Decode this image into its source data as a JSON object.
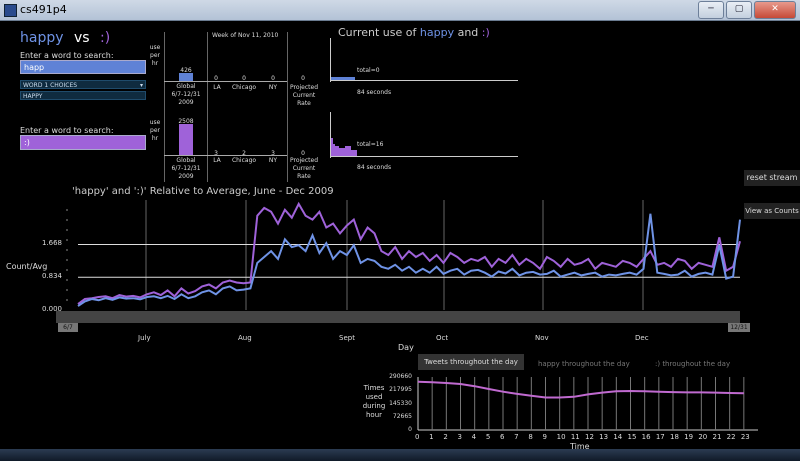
{
  "window": {
    "title": "cs491p4",
    "buttons": [
      "─",
      "▢",
      "✕"
    ]
  },
  "header": {
    "word1": "happy",
    "vs": "vs",
    "word2": ":)"
  },
  "search1": {
    "label": "Enter a word to search:",
    "value": "happ",
    "dropdown_title": "WORD 1 CHOICES",
    "dropdown_choice": "HAPPY"
  },
  "search2": {
    "label": "Enter a word to search:",
    "value": ":)"
  },
  "stats": {
    "axis_label": [
      "use",
      "per",
      "hr"
    ],
    "week": "Week of Nov 11, 2010",
    "row1": {
      "global_value": "426",
      "la": "0",
      "chicago": "0",
      "ny": "0",
      "projected": "0"
    },
    "row2": {
      "global_value": "2508",
      "la": "3",
      "chicago": "2",
      "ny": "3",
      "projected": "0"
    },
    "labels": {
      "global": "Global",
      "global_range": "6/7-12/31",
      "global_year": "2009",
      "la": "LA",
      "chicago": "Chicago",
      "ny": "NY",
      "projected": "Projected",
      "current": "Current",
      "rate": "Rate"
    }
  },
  "current_use": {
    "title_prefix": "Current use of",
    "word1": "happy",
    "and": "and",
    "word2": ":)",
    "total1": "total=0",
    "seconds1": "84 seconds",
    "total2": "total=16",
    "seconds2": "84 seconds"
  },
  "buttons": {
    "reset": "reset stream",
    "view": "View as Counts"
  },
  "main_chart": {
    "title": "'happy'  and  ':)'  Relative to Average, June - Dec 2009",
    "ylabel": "Count/Avg",
    "xlabel": "Day",
    "start": "6/7",
    "end": "12/31"
  },
  "hourly": {
    "tabs": [
      "Tweets throughout the day",
      "happy throughout the day",
      ":) throughout the day"
    ],
    "ylabel": [
      "Times",
      "used",
      "during",
      "hour"
    ],
    "xlabel": "Time"
  },
  "chart_data": [
    {
      "type": "line",
      "title": "'happy'  and  ':)'  Relative to Average, June - Dec 2009",
      "xlabel": "Day",
      "ylabel": "Count/Avg",
      "y_ticks": [
        "0.000",
        "0.834",
        "1.668"
      ],
      "x_ticks": [
        "July",
        "Aug",
        "Sept",
        "Oct",
        "Nov",
        "Dec"
      ],
      "ylim": [
        0,
        2.8
      ],
      "series": [
        {
          "color": "#6f93e6",
          "values": [
            0.1,
            0.22,
            0.28,
            0.25,
            0.3,
            0.26,
            0.32,
            0.29,
            0.3,
            0.27,
            0.33,
            0.35,
            0.3,
            0.36,
            0.28,
            0.4,
            0.3,
            0.35,
            0.45,
            0.5,
            0.4,
            0.55,
            0.6,
            0.5,
            0.52,
            0.55,
            1.2,
            1.35,
            1.5,
            1.3,
            1.8,
            1.6,
            1.65,
            1.5,
            1.9,
            1.45,
            1.7,
            1.3,
            1.5,
            1.4,
            1.65,
            1.2,
            1.3,
            1.25,
            1.1,
            1.05,
            1.15,
            1.0,
            1.1,
            0.95,
            1.05,
            0.95,
            1.1,
            0.92,
            1.0,
            1.05,
            0.9,
            1.0,
            1.02,
            0.95,
            0.85,
            0.98,
            0.93,
            1.05,
            0.88,
            0.95,
            0.97,
            0.9,
            0.92,
            1.0,
            0.85,
            0.9,
            0.95,
            0.88,
            0.92,
            0.95,
            0.85,
            0.9,
            0.88,
            0.92,
            0.95,
            0.9,
            1.05,
            2.45,
            0.95,
            0.92,
            0.88,
            0.9,
            1.0,
            0.85,
            0.92,
            0.95,
            0.9,
            1.65,
            0.8,
            0.85,
            2.3
          ]
        },
        {
          "color": "#9f62d9",
          "values": [
            0.15,
            0.28,
            0.3,
            0.33,
            0.35,
            0.3,
            0.38,
            0.34,
            0.36,
            0.32,
            0.4,
            0.45,
            0.38,
            0.5,
            0.35,
            0.55,
            0.42,
            0.48,
            0.6,
            0.65,
            0.55,
            0.7,
            0.75,
            0.7,
            0.68,
            0.7,
            2.4,
            2.6,
            2.5,
            2.2,
            2.55,
            2.35,
            2.7,
            2.4,
            2.3,
            2.5,
            2.1,
            2.2,
            1.95,
            2.15,
            2.3,
            1.8,
            2.1,
            1.95,
            1.5,
            1.4,
            1.6,
            1.3,
            1.5,
            1.35,
            1.45,
            1.25,
            1.4,
            1.2,
            1.45,
            1.35,
            1.2,
            1.3,
            1.25,
            1.35,
            1.1,
            1.3,
            1.2,
            1.4,
            1.15,
            1.3,
            1.2,
            1.05,
            1.35,
            1.25,
            1.1,
            1.3,
            1.15,
            1.2,
            1.3,
            1.05,
            1.2,
            1.15,
            1.1,
            1.25,
            1.2,
            1.1,
            1.3,
            1.5,
            1.15,
            1.2,
            1.1,
            1.3,
            1.25,
            1.05,
            1.2,
            1.15,
            1.1,
            1.85,
            1.0,
            1.1,
            1.75
          ]
        }
      ]
    },
    {
      "type": "line",
      "title": "Tweets throughout the day",
      "xlabel": "Time",
      "ylabel": "Times used during hour",
      "x": [
        0,
        1,
        2,
        3,
        4,
        5,
        6,
        7,
        8,
        9,
        10,
        11,
        12,
        13,
        14,
        15,
        16,
        17,
        18,
        19,
        20,
        21,
        22,
        23
      ],
      "y_ticks": [
        "0",
        "72665",
        "145330",
        "217995",
        "290660"
      ],
      "ylim": [
        0,
        290660
      ],
      "series": [
        {
          "color": "#c06ad0",
          "values": [
            265000,
            262000,
            258000,
            252000,
            240000,
            225000,
            210000,
            198000,
            188000,
            178000,
            178000,
            182000,
            195000,
            205000,
            212000,
            214000,
            213000,
            210000,
            208000,
            206000,
            206000,
            205000,
            203000,
            201000
          ]
        }
      ]
    }
  ]
}
